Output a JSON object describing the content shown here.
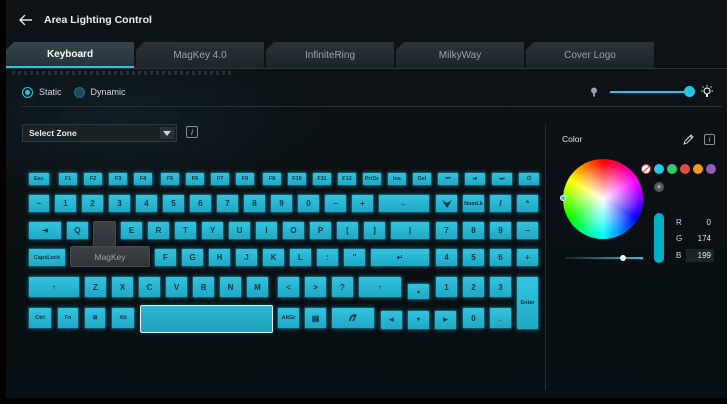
{
  "app": {
    "title": "Area Lighting Control"
  },
  "tabs": [
    {
      "label": "Keyboard",
      "active": true
    },
    {
      "label": "MagKey 4.0"
    },
    {
      "label": "InfiniteRing"
    },
    {
      "label": "MilkyWay"
    },
    {
      "label": "Cover Logo"
    }
  ],
  "mode": {
    "static_label": "Static",
    "dynamic_label": "Dynamic",
    "selected": "Static"
  },
  "zone_select": {
    "value": "Select Zone",
    "info": "i"
  },
  "brightness": {
    "level": 1.0
  },
  "keys": [
    "Esc",
    "F1",
    "F2",
    "F3",
    "F4",
    "F5",
    "F6",
    "F7",
    "F8",
    "F9",
    "F10",
    "F11",
    "F12",
    "PrtSc",
    "Ins",
    "Del",
    "⏮",
    "⏯",
    "⏭",
    "⏻",
    "~",
    "1",
    "2",
    "3",
    "4",
    "5",
    "6",
    "7",
    "8",
    "9",
    "0",
    "−",
    "+",
    "←",
    "",
    "NumLk",
    "/",
    "*",
    "⇥",
    "Q",
    "",
    "E",
    "R",
    "T",
    "Y",
    "U",
    "I",
    "O",
    "P",
    "[",
    "]",
    "|",
    "7",
    "8",
    "9",
    "−",
    "CapsLock",
    "MagKey",
    "F",
    "G",
    "H",
    "J",
    "K",
    "L",
    ":",
    "\"",
    "↵",
    "4",
    "5",
    "6",
    "+",
    "↑",
    "Z",
    "X",
    "C",
    "V",
    "B",
    "N",
    "M",
    "<",
    ">",
    "?",
    "↑",
    "▲",
    "1",
    "2",
    "3",
    "Enter",
    "Ctrl",
    "Fn",
    "⊞",
    "Alt",
    "",
    "AltGr",
    "▤",
    "",
    "◀",
    "▼",
    "▶",
    "0",
    "."
  ],
  "color": {
    "label": "Color",
    "info": "i",
    "swatches": [
      "#29c5e6",
      "#2ecc71",
      "#e74c3c",
      "#f39c12",
      "#e67e22",
      "#9b59b6"
    ],
    "r_label": "R",
    "g_label": "G",
    "b_label": "B",
    "r": "0",
    "g": "174",
    "b": "199",
    "selected_hex": "#00aec7"
  }
}
